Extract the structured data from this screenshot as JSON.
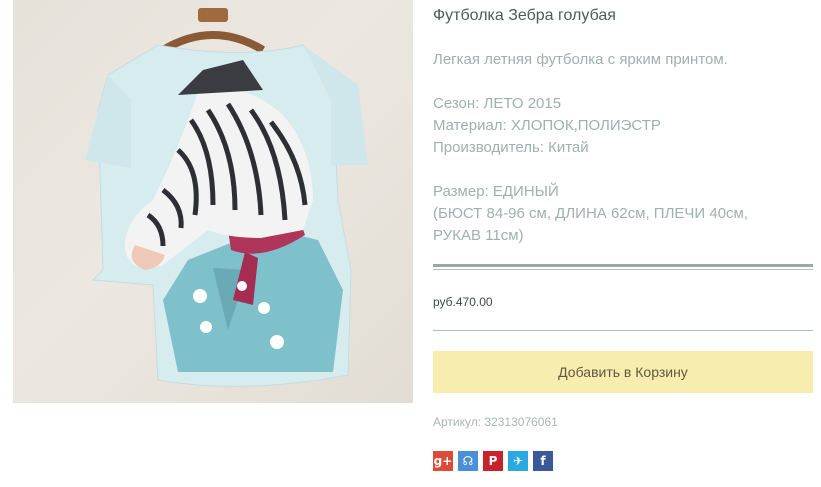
{
  "product": {
    "title": "Футболка Зебра голубая",
    "description": "Легкая летняя футболка с ярким принтом.",
    "season": "Сезон: ЛЕТО 2015",
    "material": "Материал: ХЛОПОК,ПОЛИЭСТР",
    "manufacturer": "Производитель: Китай",
    "size_title": "Размер: ЕДИНЫЙ",
    "size_line1": "(БЮСТ 84-96 см, ДЛИНА 62см, ПЛЕЧИ 40см,",
    "size_line2": "РУКАВ 11см)",
    "price": "руб.470.00",
    "add_to_cart": "Добавить в Корзину",
    "sku": "Артикул: 32313076061"
  },
  "share": [
    {
      "name": "google-plus-icon",
      "glyph": "g+",
      "color": "#dc4a38"
    },
    {
      "name": "odnoklassniki-icon",
      "glyph": "☊",
      "color": "#4a90d9"
    },
    {
      "name": "pinterest-icon",
      "glyph": "P",
      "color": "#c8232c"
    },
    {
      "name": "twitter-icon",
      "glyph": "✈",
      "color": "#2aa9e0"
    },
    {
      "name": "facebook-icon",
      "glyph": "f",
      "color": "#3b5998"
    }
  ]
}
